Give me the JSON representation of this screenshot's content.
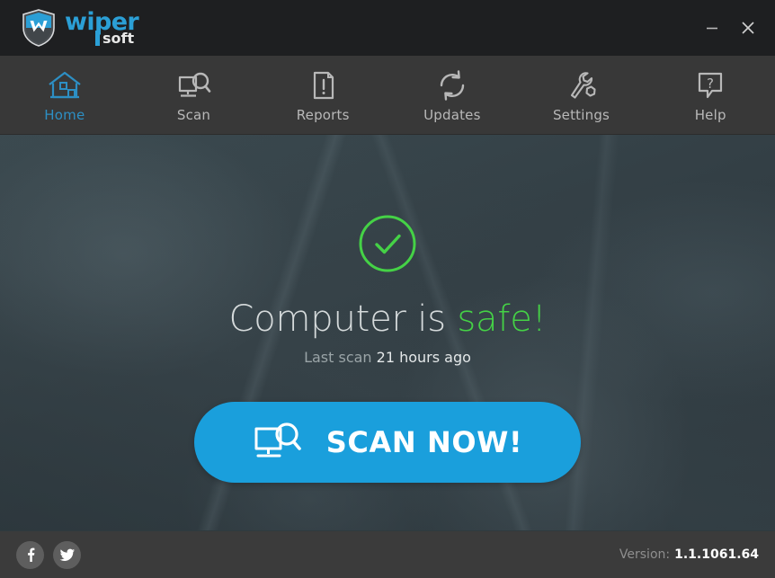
{
  "window": {
    "app_name": "WiperSoft",
    "logo_primary": "wiper",
    "logo_secondary": "soft",
    "minimize_label": "–",
    "close_label": "×",
    "titlebar_color": "#1e1f21",
    "accent_color": "#1a9fdc"
  },
  "nav": {
    "items": [
      {
        "label": "Home",
        "icon": "home-icon",
        "active": true
      },
      {
        "label": "Scan",
        "icon": "scan-icon",
        "active": false
      },
      {
        "label": "Reports",
        "icon": "reports-icon",
        "active": false
      },
      {
        "label": "Updates",
        "icon": "updates-icon",
        "active": false
      },
      {
        "label": "Settings",
        "icon": "settings-icon",
        "active": false
      },
      {
        "label": "Help",
        "icon": "help-icon",
        "active": false
      }
    ],
    "active_color": "#2d8fc4",
    "inactive_color": "#b8b8b8",
    "background_color": "#383838"
  },
  "main": {
    "status_icon": "check-circle-icon",
    "status_color": "#45d246",
    "status_prefix": "Computer is ",
    "status_word": "safe!",
    "last_scan_label": "Last scan ",
    "last_scan_value": "21 hours ago",
    "scan_button_label": "SCAN NOW!",
    "scan_button_icon": "monitor-search-icon",
    "scan_button_color": "#1a9fdc"
  },
  "footer": {
    "social": [
      {
        "name": "facebook-icon",
        "label": "f"
      },
      {
        "name": "twitter-icon",
        "label": "t"
      }
    ],
    "version_label": "Version:",
    "version_number": "1.1.1061.64"
  }
}
